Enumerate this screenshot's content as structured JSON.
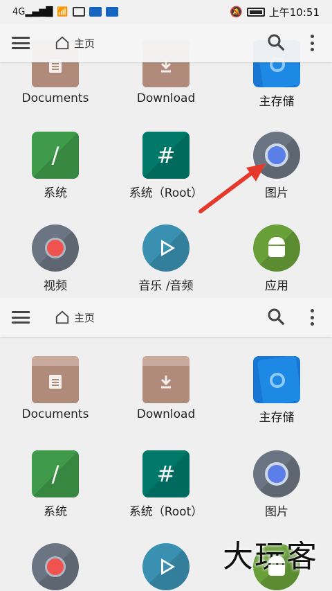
{
  "status_bar": {
    "network": "4G",
    "time": "上午10:51"
  },
  "toolbar": {
    "title": "主页",
    "icons": [
      "menu-icon",
      "home-icon",
      "search-icon",
      "more-vert-icon"
    ]
  },
  "items": [
    {
      "label": "Documents",
      "icon": "documents-folder-icon"
    },
    {
      "label": "Download",
      "icon": "download-folder-icon"
    },
    {
      "label": "主存储",
      "icon": "storage-icon"
    },
    {
      "label": "系统",
      "icon": "system-slash-icon"
    },
    {
      "label": "系统（Root）",
      "icon": "root-hash-icon"
    },
    {
      "label": "图片",
      "icon": "camera-lens-icon"
    },
    {
      "label": "视频",
      "icon": "video-record-icon"
    },
    {
      "label": "音乐 /音频",
      "icon": "play-icon"
    },
    {
      "label": "应用",
      "icon": "android-icon"
    }
  ],
  "glyphs": {
    "system": "/",
    "root": "#"
  },
  "annotation": {
    "arrow_color": "#e53a2b"
  },
  "watermark": "大玩客"
}
